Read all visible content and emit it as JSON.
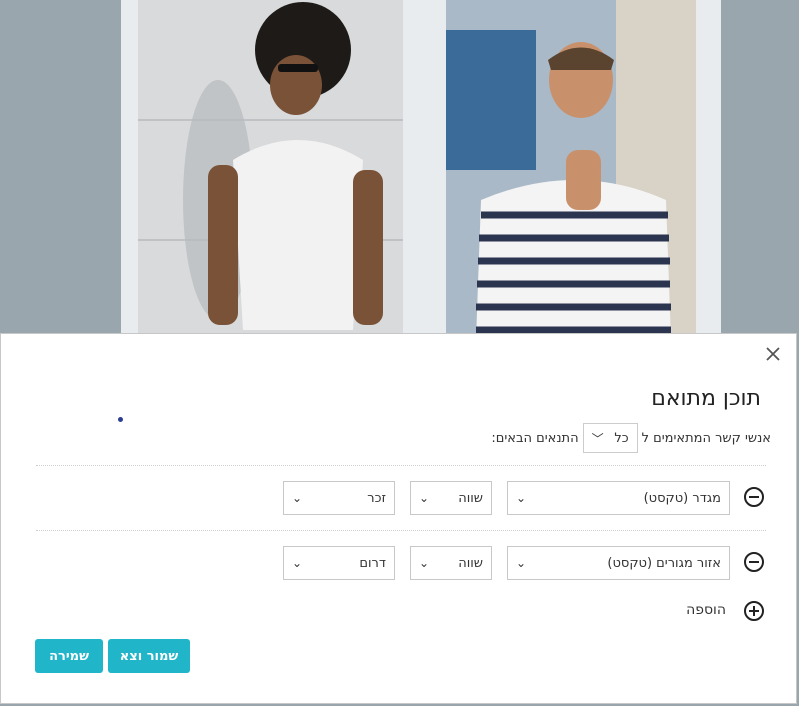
{
  "modal": {
    "title": "תוכן מתואם",
    "match_prefix": "אנשי קשר המתאימים ל",
    "match_value": "כל",
    "match_suffix": "התנאים הבאים:",
    "rules": [
      {
        "field": "מגדר (טקסט)",
        "operator": "שווה",
        "value": "זכר"
      },
      {
        "field": "אזור מגורים (טקסט)",
        "operator": "שווה",
        "value": "דרום"
      }
    ],
    "add_label": "הוספה",
    "buttons": {
      "save_exit": "שמור וצא",
      "save": "שמירה"
    }
  },
  "colors": {
    "accent": "#20b5c8"
  },
  "icons": {
    "close": "close-icon",
    "remove": "minus-circle-icon",
    "add": "plus-circle-icon",
    "dropdown": "chevron-down-icon"
  }
}
